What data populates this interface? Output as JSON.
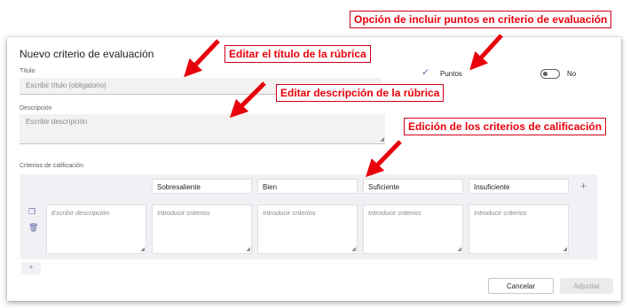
{
  "annotations": {
    "points_option": "Opción de incluir puntos en criterio de evaluación",
    "edit_title": "Editar el título de la rúbrica",
    "edit_description": "Editar descripción de la rúbrica",
    "edit_criteria": "Edición de los criterios de calificación",
    "color": "#e8000b"
  },
  "dialog": {
    "title": "Nuevo criterio de evaluación",
    "title_label": "Título",
    "title_placeholder": "Escribir título (obligatorio)",
    "description_label": "Descripción",
    "description_placeholder": "Escribir descripción",
    "points_label": "Puntos",
    "points_toggle_value": "No",
    "criteria_label": "Criterios de calificación",
    "columns": [
      "Sobresaliente",
      "Bien",
      "Suficiente",
      "Insuficiente"
    ],
    "row_description_placeholder": "Escribir descripción",
    "criteria_placeholder": "Introducir criterios",
    "cancel_label": "Cancelar",
    "add_label": "Adjuntar",
    "accent_color": "#6264a7"
  }
}
